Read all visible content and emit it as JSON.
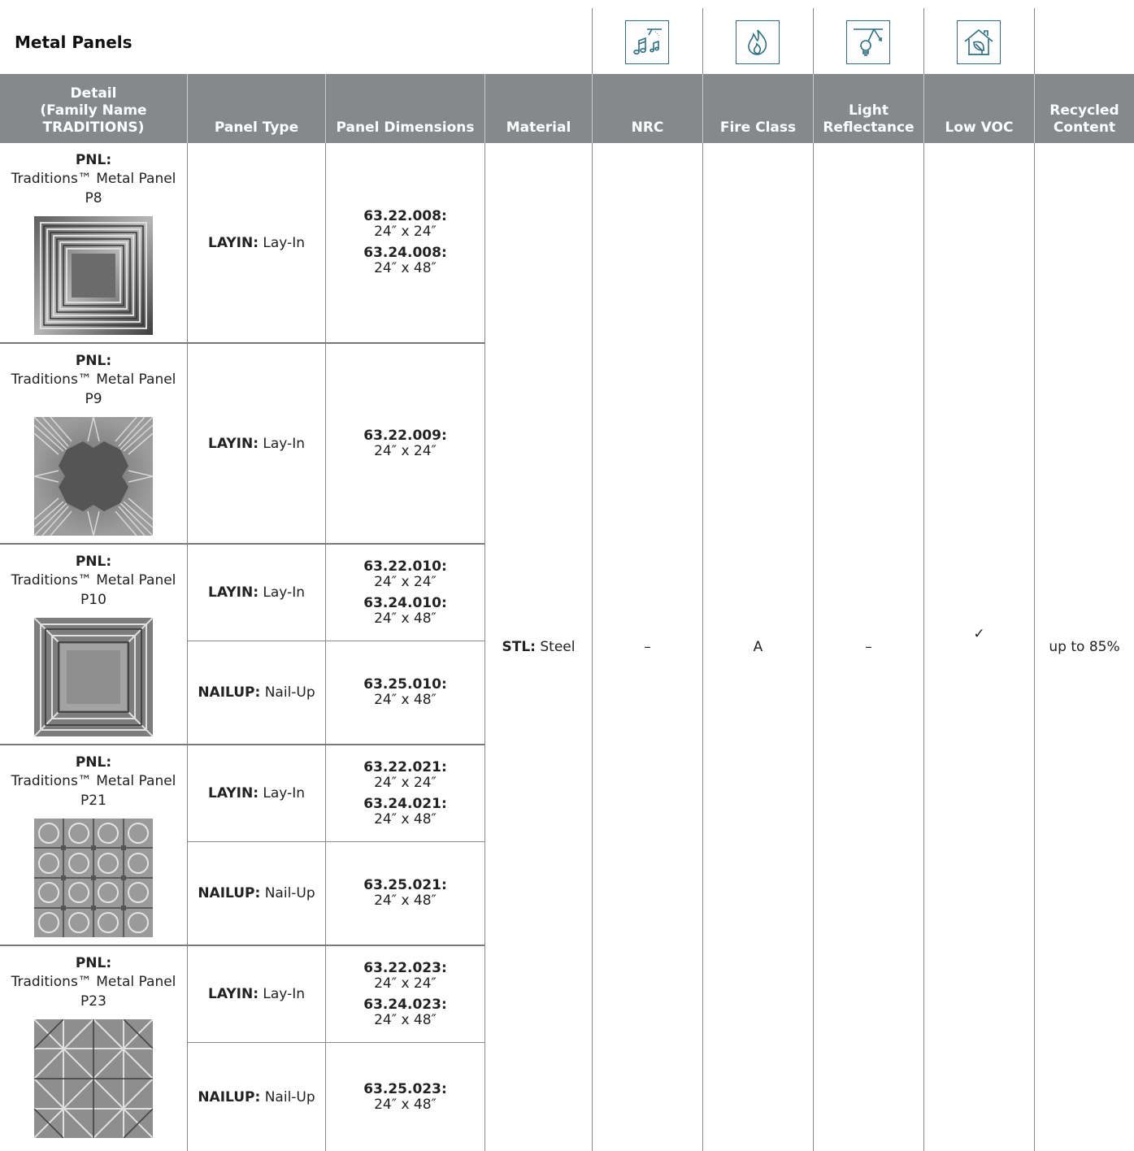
{
  "title": "Metal Panels",
  "icons": [
    "acoustics-music-icon",
    "fire-icon",
    "light-reflectance-bulb-icon",
    "low-voc-house-leaf-icon"
  ],
  "colors": {
    "header_bg": "#85898c",
    "icon_stroke": "#2a6f85"
  },
  "headers": {
    "detail": [
      "Detail",
      "(Family Name",
      "TRADITIONS)"
    ],
    "panel_type": "Panel Type",
    "panel_dimensions": "Panel Dimensions",
    "material": "Material",
    "nrc": "NRC",
    "fire_class": "Fire Class",
    "light_reflectance": [
      "Light",
      "Reflectance"
    ],
    "low_voc": "Low VOC",
    "recycled_content": [
      "Recycled",
      "Content"
    ]
  },
  "shared": {
    "material_code": "STL:",
    "material_name": "Steel",
    "nrc": "–",
    "fire_class": "A",
    "light_reflectance": "–",
    "low_voc": "✓",
    "recycled_content": "up to 85%"
  },
  "rows": [
    {
      "detail_code": "PNL:",
      "detail_name": "Traditions™ Metal Panel",
      "panel": "P8",
      "pattern": "square-steps",
      "types": [
        {
          "type_code": "LAYIN:",
          "type_name": "Lay-In",
          "dims": [
            {
              "code": "63.22.008:",
              "size": "24″ x 24″"
            },
            {
              "code": "63.24.008:",
              "size": "24″ x 48″"
            }
          ]
        }
      ]
    },
    {
      "detail_code": "PNL:",
      "detail_name": "Traditions™ Metal Panel",
      "panel": "P9",
      "pattern": "star-burst",
      "types": [
        {
          "type_code": "LAYIN:",
          "type_name": "Lay-In",
          "dims": [
            {
              "code": "63.22.009:",
              "size": "24″ x 24″"
            }
          ]
        }
      ]
    },
    {
      "detail_code": "PNL:",
      "detail_name": "Traditions™ Metal Panel",
      "panel": "P10",
      "pattern": "square-frame",
      "types": [
        {
          "type_code": "LAYIN:",
          "type_name": "Lay-In",
          "dims": [
            {
              "code": "63.22.010:",
              "size": "24″ x 24″"
            },
            {
              "code": "63.24.010:",
              "size": "24″ x 48″"
            }
          ]
        },
        {
          "type_code": "NAILUP:",
          "type_name": "Nail-Up",
          "dims": [
            {
              "code": "63.25.010:",
              "size": "24″ x 48″"
            }
          ]
        }
      ]
    },
    {
      "detail_code": "PNL:",
      "detail_name": "Traditions™ Metal Panel",
      "panel": "P21",
      "pattern": "circle-grid",
      "types": [
        {
          "type_code": "LAYIN:",
          "type_name": "Lay-In",
          "dims": [
            {
              "code": "63.22.021:",
              "size": "24″ x 24″"
            },
            {
              "code": "63.24.021:",
              "size": "24″ x 48″"
            }
          ]
        },
        {
          "type_code": "NAILUP:",
          "type_name": "Nail-Up",
          "dims": [
            {
              "code": "63.25.021:",
              "size": "24″ x 48″"
            }
          ]
        }
      ]
    },
    {
      "detail_code": "PNL:",
      "detail_name": "Traditions™ Metal Panel",
      "panel": "P23",
      "pattern": "diagonal-grid",
      "types": [
        {
          "type_code": "LAYIN:",
          "type_name": "Lay-In",
          "dims": [
            {
              "code": "63.22.023:",
              "size": "24″ x 24″"
            },
            {
              "code": "63.24.023:",
              "size": "24″ x 48″"
            }
          ]
        },
        {
          "type_code": "NAILUP:",
          "type_name": "Nail-Up",
          "dims": [
            {
              "code": "63.25.023:",
              "size": "24″ x 48″"
            }
          ]
        }
      ]
    }
  ]
}
